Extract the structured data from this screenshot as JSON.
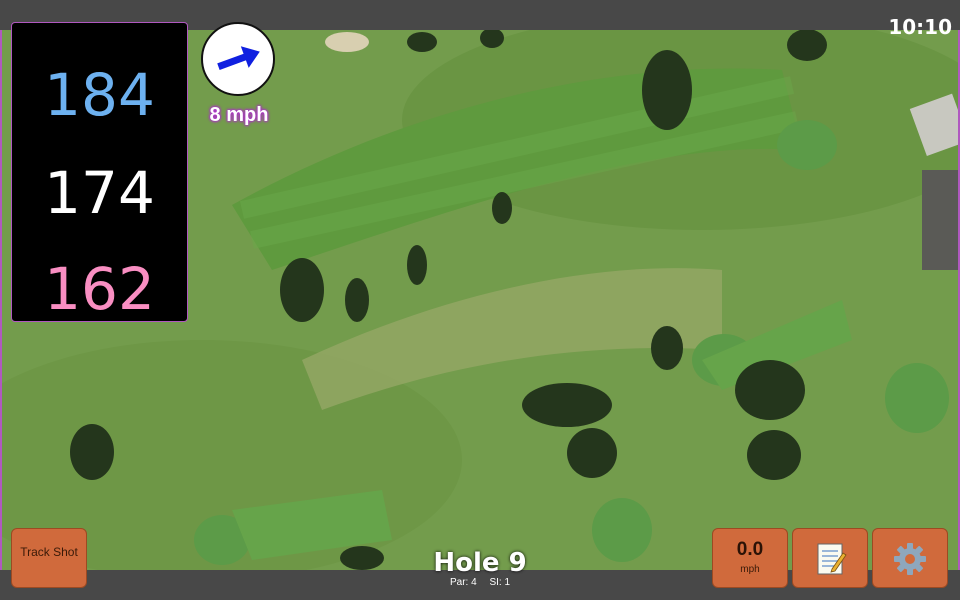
{
  "status_bar": {
    "time": "10:10"
  },
  "distances": {
    "back": "184",
    "middle": "174",
    "front": "162"
  },
  "wind": {
    "speed": "8 mph",
    "arrow_icon": "wind-arrow-icon",
    "arrow_color": "#1020e0"
  },
  "track_button": {
    "label": "Track Shot"
  },
  "speed_display": {
    "value": "0.0",
    "unit": "mph"
  },
  "hole": {
    "title": "Hole 9",
    "par": "Par: 4",
    "si": "SI: 1"
  },
  "icons": {
    "notes": "notepad-icon",
    "settings": "gear-icon"
  },
  "colors": {
    "back": "#6db1f0",
    "middle": "#ffffff",
    "front": "#f98ec2",
    "button": "#d06a3c",
    "accent": "#b058c0"
  }
}
